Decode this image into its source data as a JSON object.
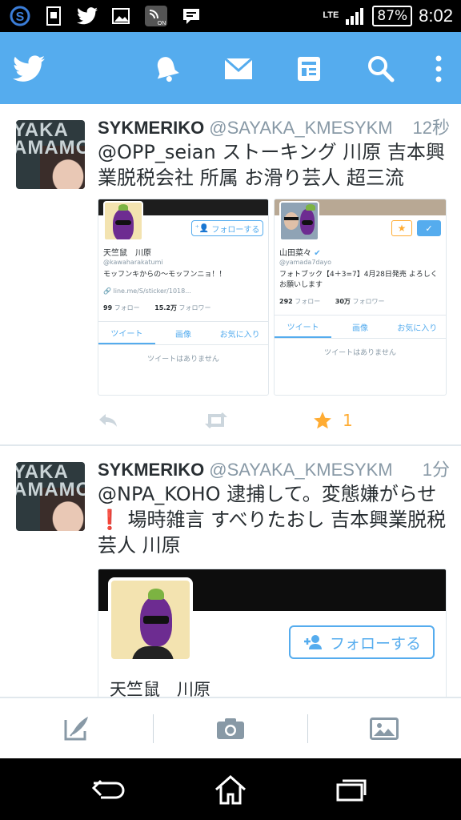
{
  "status_bar": {
    "network": "LTE",
    "battery": "87%",
    "time": "8:02",
    "icons": [
      "s-app-icon",
      "sim-icon",
      "twitter-icon",
      "image-icon",
      "nfc-on-icon",
      "message-icon"
    ],
    "nfc_label": "ON"
  },
  "app_bar": {
    "icons": [
      "twitter-logo-icon",
      "notifications-icon",
      "messages-icon",
      "lists-icon",
      "search-icon",
      "overflow-menu-icon"
    ],
    "color": "#55acee"
  },
  "tweets": [
    {
      "name": "SYKMERIKO",
      "handle": "@SAYAKA_KMESYKM",
      "time": "12秒",
      "avatar_text": "YAKA AMAMO",
      "text": "@OPP_seian ストーキング 川原 吉本興業脱税会社 所属 お滑り芸人 超三流",
      "cards": [
        {
          "follow_label": "フォローする",
          "name": "天竺鼠　川原",
          "handle": "@kawaharakatumi",
          "bio": "モッフンキからの〜モッフンニョ！！",
          "link": "line.me/S/sticker/1018...",
          "following_count": "99",
          "following_label": "フォロー",
          "followers_count": "15.2万",
          "followers_label": "フォロワー",
          "tabs": [
            "ツイート",
            "画像",
            "お気に入り"
          ],
          "empty": "ツイートはありません"
        },
        {
          "name": "山田菜々",
          "handle": "@yamada7dayo",
          "bio": "フォトブック【4＋3=7】4月28日発売 よろしくお願いします",
          "following_count": "292",
          "following_label": "フォロー",
          "followers_count": "30万",
          "followers_label": "フォロワー",
          "tabs": [
            "ツイート",
            "画像",
            "お気に入り"
          ],
          "empty": "ツイートはありません"
        }
      ],
      "favorite_count": "1"
    },
    {
      "name": "SYKMERIKO",
      "handle": "@SAYAKA_KMESYKM",
      "time": "1分",
      "avatar_text": "YAKA AMAMO",
      "text": "@NPA_KOHO 逮捕して。変態嫌がらせ❗ 場時雑言 すべりたおし 吉本興業脱税 芸人 川原",
      "card": {
        "follow_label": "フォローする",
        "name": "天竺鼠　川原"
      }
    }
  ],
  "bottom_bar": {
    "icons": [
      "compose-icon",
      "camera-icon",
      "gallery-icon"
    ]
  },
  "nav_bar": {
    "icons": [
      "back-icon",
      "home-icon",
      "recents-icon"
    ]
  }
}
